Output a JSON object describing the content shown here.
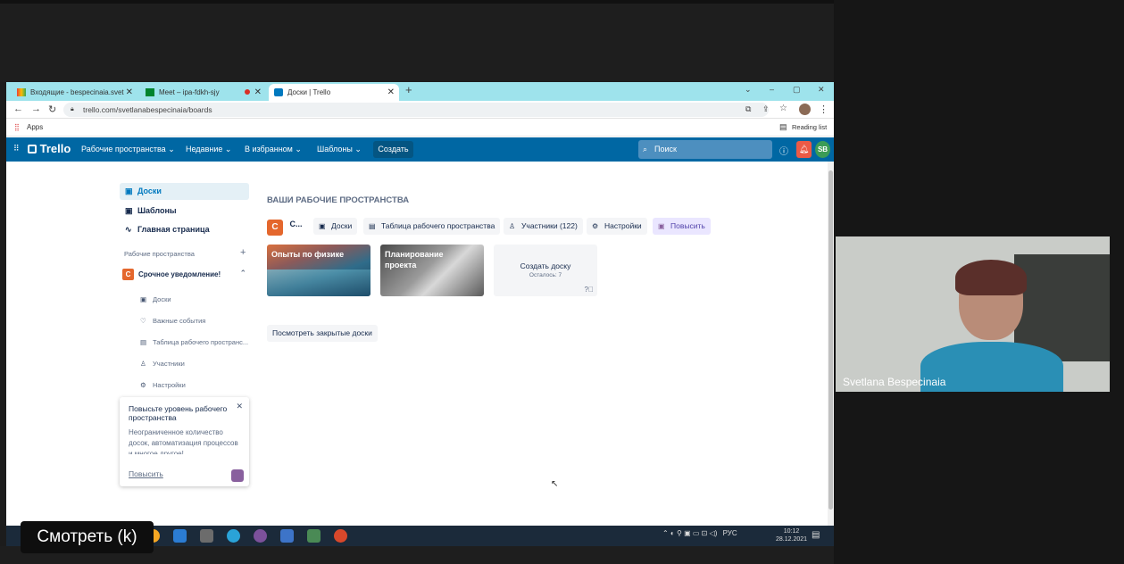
{
  "browser": {
    "tabs": [
      {
        "title": "Входящие - bespecinaia.svetlana"
      },
      {
        "title": "Meet – ipa-fdkh-sjy"
      },
      {
        "title": "Доски | Trello"
      }
    ],
    "new_tab": "+",
    "url": "trello.com/svetlanabespecinaia/boards",
    "bookmarks_apps": "Apps",
    "reading_list": "Reading list"
  },
  "trello": {
    "logo": "Trello",
    "nav": [
      "Рабочие пространства",
      "Недавние",
      "В избранном",
      "Шаблоны"
    ],
    "create": "Создать",
    "search_placeholder": "Поиск",
    "avatar_initials": "SB"
  },
  "sidebar": {
    "items": [
      "Доски",
      "Шаблоны",
      "Главная страница"
    ],
    "workspaces_label": "Рабочие пространства",
    "workspace_name": "Срочное уведомление!",
    "workspace_letter": "С",
    "subitems": [
      "Доски",
      "Важные события",
      "Таблица рабочего пространс...",
      "Участники",
      "Настройки"
    ]
  },
  "upsell": {
    "title": "Повысьте уровень рабочего пространства",
    "body": "Неограниченное количество досок, автоматизация процессов и многое другое!",
    "link": "Повысить"
  },
  "main": {
    "heading": "ВАШИ РАБОЧИЕ ПРОСТРАНСТВА",
    "workspace_short": "С...",
    "buttons": [
      "Доски",
      "Таблица рабочего пространства",
      "Участники (122)",
      "Настройки",
      "Повысить"
    ],
    "boards": [
      {
        "title": "Опыты по физике"
      },
      {
        "title": "Планирование проекта"
      }
    ],
    "create_board": "Создать доску",
    "remaining": "Осталось: 7",
    "closed_boards": "Посмотреть закрытые доски"
  },
  "taskbar": {
    "lang": "РУС",
    "time": "10:12",
    "date": "28.12.2021"
  },
  "video": {
    "participant": "Svetlana Bespecinaia"
  },
  "overlay": {
    "watch": "Смотреть (k)"
  }
}
